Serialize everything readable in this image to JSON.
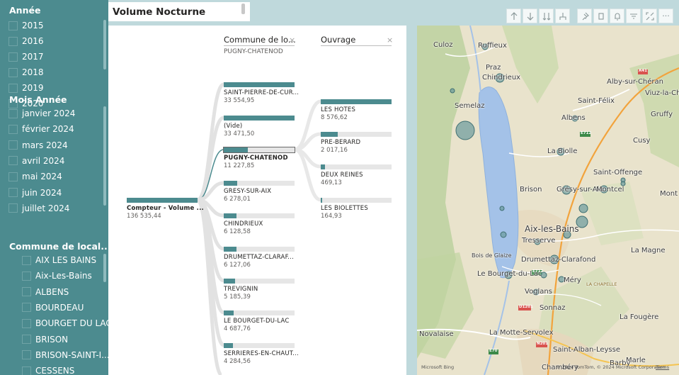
{
  "slicers": {
    "annee": {
      "title": "Année",
      "items": [
        "2015",
        "2016",
        "2017",
        "2018",
        "2019",
        "2020"
      ]
    },
    "mois": {
      "title": "Mois Année",
      "items": [
        "janvier 2024",
        "février 2024",
        "mars 2024",
        "avril 2024",
        "mai 2024",
        "juin 2024",
        "juillet 2024"
      ]
    },
    "commune": {
      "title": "Commune de local...",
      "items": [
        "AIX LES BAINS",
        "Aix-Les-Bains",
        "ALBENS",
        "BOURDEAU",
        "BOURGET DU LAC",
        "BRISON",
        "BRISON-SAINT-I...",
        "CESSENS"
      ]
    }
  },
  "visual": {
    "title": "Volume Nocturne"
  },
  "toolbar": {
    "buttons": [
      "arrow-up-icon",
      "arrow-down-icon",
      "double-arrow-down-icon",
      "expand-hierarchy-icon",
      "pin-icon",
      "copy-icon",
      "bell-icon",
      "filter-icon",
      "focus-mode-icon",
      "more-options-icon"
    ],
    "more_label": "···"
  },
  "decomposition": {
    "root": {
      "label": "Compteur - Volume ...",
      "value": "136 535,44"
    },
    "commune_column": {
      "header": "Commune de lo...",
      "close": "×",
      "selected_label": "PUGNY-CHATENOD",
      "nodes": [
        {
          "label": "SAINT-PIERRE-DE-CUR...",
          "value": "33 554,95",
          "fraction": 1.0
        },
        {
          "label": "(Vide)",
          "value": "33 471,50",
          "fraction": 0.998
        },
        {
          "label": "PUGNY-CHATENOD",
          "value": "11 227,85",
          "fraction": 0.335,
          "selected": true
        },
        {
          "label": "GRESY-SUR-AIX",
          "value": "6 278,01",
          "fraction": 0.187
        },
        {
          "label": "CHINDRIEUX",
          "value": "6 128,58",
          "fraction": 0.183
        },
        {
          "label": "DRUMETTAZ-CLARAF...",
          "value": "6 127,06",
          "fraction": 0.183
        },
        {
          "label": "TREVIGNIN",
          "value": "5 185,39",
          "fraction": 0.155
        },
        {
          "label": "LE BOURGET-DU-LAC",
          "value": "4 687,76",
          "fraction": 0.14
        },
        {
          "label": "SERRIERES-EN-CHAUT...",
          "value": "4 284,56",
          "fraction": 0.128
        }
      ]
    },
    "ouvrage_column": {
      "header": "Ouvrage",
      "close": "×",
      "nodes": [
        {
          "label": "LES HOTES",
          "value": "8 576,62",
          "fraction": 1.0
        },
        {
          "label": "PRE-BERARD",
          "value": "2 017,16",
          "fraction": 0.235
        },
        {
          "label": "DEUX REINES",
          "value": "469,13",
          "fraction": 0.055
        },
        {
          "label": "LES BIOLETTES",
          "value": "164,93",
          "fraction": 0.019
        }
      ]
    }
  },
  "map": {
    "labels": [
      "Culoz",
      "Ruffieux",
      "Praz",
      "Chindrieux",
      "Alby-sur-Chéran",
      "Viuz-la-Ch",
      "Semelaz",
      "Saint-Félix",
      "Gruffy",
      "Albens",
      "Cusy",
      "La Biolle",
      "Saint-Offenge",
      "Brison",
      "Grésy-sur-Aix",
      "Montcel",
      "Mont",
      "Aix-les-Bains",
      "Tresserve",
      "La Magne",
      "Bois de Glaize",
      "Drumettaz-Clarafond",
      "Le Bourget-du-Lac",
      "Méry",
      "LA CHAPELLE",
      "Voglans",
      "Sonnaz",
      "La Fougère",
      "Novalaise",
      "La Motte-Servolex",
      "Saint-Alban-Leysse",
      "Marle",
      "Barby",
      "Chambéry"
    ],
    "road_labels": [
      "A41",
      "E712",
      "E712",
      "D1201",
      "N201",
      "E70"
    ],
    "footer_logo": "Microsoft Bing",
    "footer_copyright": "© 2024 TomTom, © 2024 Microsoft Corporation",
    "footer_terms": "Terms"
  }
}
